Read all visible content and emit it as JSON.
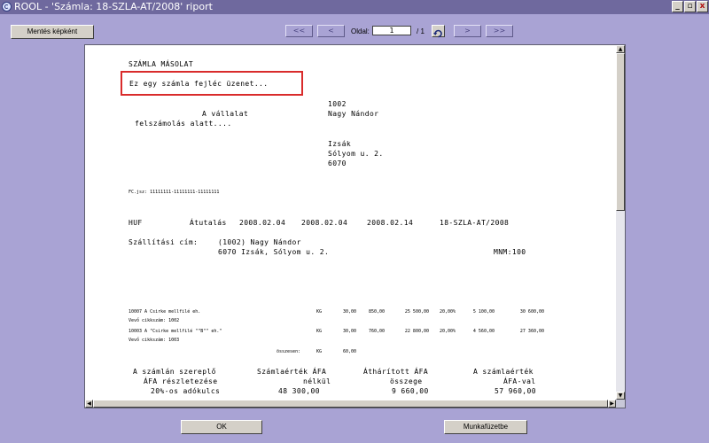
{
  "window": {
    "title": "ROOL  -  'Számla: 18-SZLA-AT/2008' riport",
    "minimize": "_",
    "restore": "▫",
    "close": "x"
  },
  "toolbar": {
    "save_image_label": "Mentés képként",
    "first_label": "<<",
    "prev_label": "<",
    "page_label": "Oldal:",
    "page_value": "1",
    "page_total": "/ 1",
    "next_label": ">",
    "last_label": ">>"
  },
  "report": {
    "title": "SZÁMLA MÁSOLAT",
    "header_message": "Ez egy számla fejléc üzenet...",
    "seller_line1": "A vállalat",
    "seller_line2": "felszámolás alatt....",
    "customer_code": "1002",
    "customer_name": "Nagy Nándor",
    "customer_city": "Izsák",
    "customer_street": "Sólyom u. 2.",
    "customer_zip": "6070",
    "tax_line": "FC.jsz: 11111111-11111111-11111111",
    "currency": "HUF",
    "payment_method": "Átutalás",
    "date1": "2008.02.04",
    "date2": "2008.02.04",
    "date3": "2008.02.14",
    "invoice_no": "18-SZLA-AT/2008",
    "delivery_label": "Szállítási cím:",
    "delivery_line1": "(1002) Nagy Nándor",
    "delivery_line2": "6070 Izsák, Sólyom u. 2.",
    "mnm": "MNM:100",
    "items": [
      {
        "name": "10007 A Csirke mellfilé eh.",
        "unit": "KG",
        "qty": "30,00",
        "price": "850,00",
        "net": "25 500,00",
        "vat_rate": "20,00%",
        "vat": "5 100,00",
        "gross": "30 600,00",
        "sub": "Vevő cikkszám: 1002"
      },
      {
        "name": "10003 A \"Csirke mellfilé \"\"B\"\" eh.\"",
        "unit": "KG",
        "qty": "30,00",
        "price": "760,00",
        "net": "22 800,00",
        "vat_rate": "20,00%",
        "vat": "4 560,00",
        "gross": "27 360,00",
        "sub": "Vevő cikkszám: 1003"
      }
    ],
    "total_label": "összesen:",
    "total_unit": "KG",
    "total_qty": "60,00",
    "vat_summary": {
      "h1_a": "A számlán szereplő",
      "h2_a": "ÁFA részletezése",
      "h1_b": "Számlaérték ÁFA",
      "h2_b": "nélkül",
      "h1_c": "Áthárított ÁFA",
      "h2_c": "összege",
      "h1_d": "A számlaérték",
      "h2_d": "ÁFA-val",
      "row_label": "20%-os adókulcs",
      "row_net": "48 300,00",
      "row_vat": "9 660,00",
      "row_gross": "57 960,00"
    }
  },
  "bottom": {
    "ok_label": "OK",
    "workbench_label": "Munkafüzetbe"
  }
}
